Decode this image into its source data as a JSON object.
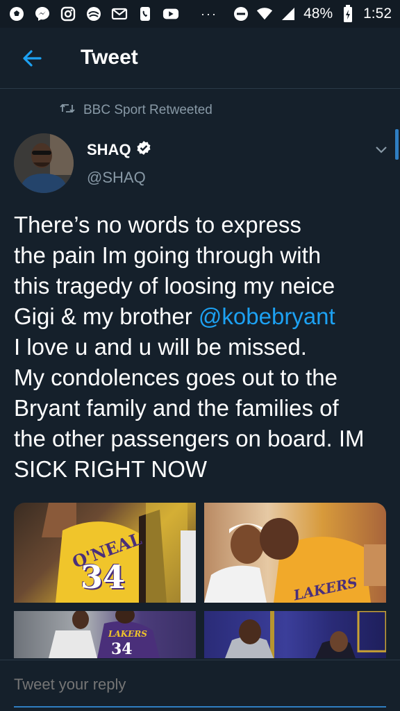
{
  "status_bar": {
    "icons_left": [
      "soccer-ball-icon",
      "messenger-icon",
      "instagram-icon",
      "swirl-app-icon",
      "gmail-icon",
      "phone-app-icon",
      "youtube-icon"
    ],
    "more": "···",
    "battery": "48%",
    "time": "1:52"
  },
  "header": {
    "title": "Tweet"
  },
  "retweet": {
    "label": "BBC Sport Retweeted"
  },
  "author": {
    "name": "SHAQ",
    "handle": "@SHAQ",
    "verified": true
  },
  "tweet": {
    "line1": "There’s no words to express",
    "line2": "the pain Im going through with",
    "line3": "this tragedy of loosing my neice",
    "line4_pre": "Gigi & my brother ",
    "mention": "@kobebryant",
    "line5": "I love u and u will be missed.",
    "line6": "My condolences goes out to the",
    "line7": "Bryant family and the families of",
    "line8": "the other passengers on board. IM",
    "line9": "SICK RIGHT NOW"
  },
  "media": {
    "m1_name": "O'NEAL",
    "m1_number": "34",
    "m2_team": "LAKERS",
    "m3_team": "LAKERS",
    "m3_number": "34"
  },
  "reply": {
    "placeholder": "Tweet your reply"
  },
  "colors": {
    "background": "#15202b",
    "accent": "#1da1f2",
    "secondary_text": "#8899a6"
  }
}
